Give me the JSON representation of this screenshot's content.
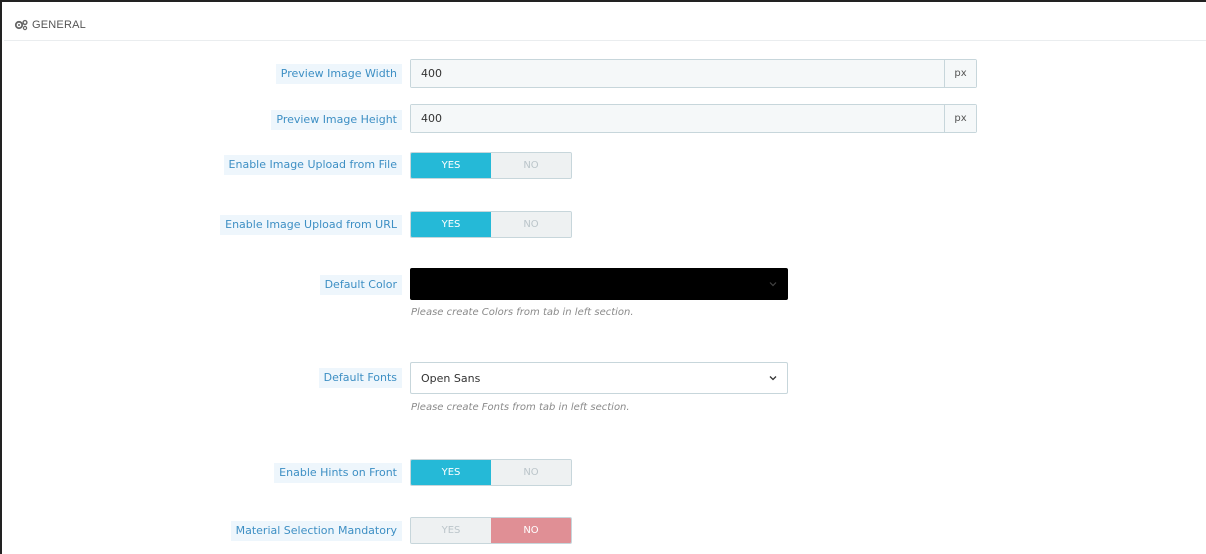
{
  "panel": {
    "title": "GENERAL",
    "icon": "gears-icon"
  },
  "fields": {
    "preview_width": {
      "label": "Preview Image Width",
      "value": "400",
      "unit": "px"
    },
    "preview_height": {
      "label": "Preview Image Height",
      "value": "400",
      "unit": "px"
    },
    "upload_file": {
      "label": "Enable Image Upload from File",
      "yes": "YES",
      "no": "NO",
      "selected": "YES"
    },
    "upload_url": {
      "label": "Enable Image Upload from URL",
      "yes": "YES",
      "no": "NO",
      "selected": "YES"
    },
    "default_color": {
      "label": "Default Color",
      "value": "",
      "help": "Please create Colors from tab in left section.",
      "swatch": "#000000"
    },
    "default_fonts": {
      "label": "Default Fonts",
      "value": "Open Sans",
      "help": "Please create Fonts from tab in left section."
    },
    "hints_front": {
      "label": "Enable Hints on Front",
      "yes": "YES",
      "no": "NO",
      "selected": "YES"
    },
    "material_mandatory": {
      "label": "Material Selection Mandatory",
      "yes": "YES",
      "no": "NO",
      "selected": "NO"
    }
  },
  "colors": {
    "accent": "#25b9d7",
    "danger": "#e08f95",
    "label_bg": "#eef6fc",
    "label_text": "#3d8fc4"
  }
}
